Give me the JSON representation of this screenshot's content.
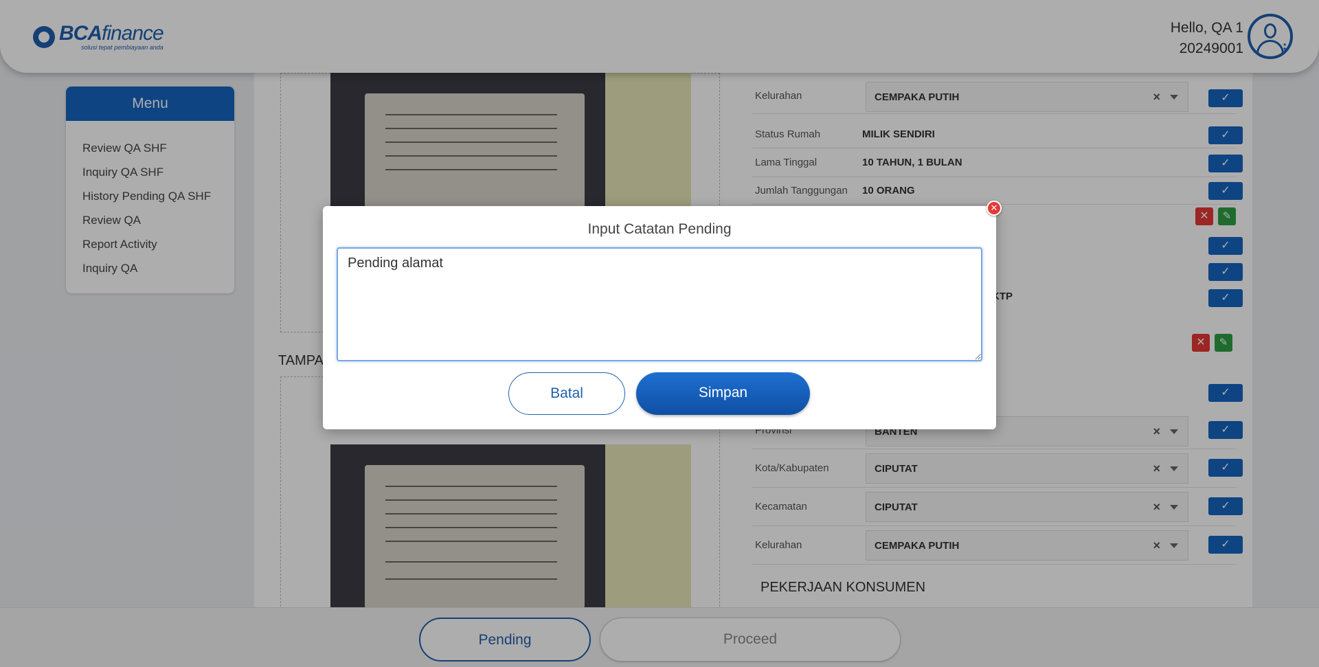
{
  "header": {
    "logo_brand": "BCA",
    "logo_finance": "finance",
    "logo_tagline": "solusi tepat pembiayaan anda",
    "greeting": "Hello, QA 1",
    "user_id": "20249001"
  },
  "menu": {
    "title": "Menu",
    "items": [
      {
        "label": "Review QA SHF"
      },
      {
        "label": "Inquiry QA SHF"
      },
      {
        "label": "History Pending QA SHF"
      },
      {
        "label": "Review QA"
      },
      {
        "label": "Report Activity"
      },
      {
        "label": "Inquiry QA"
      }
    ]
  },
  "left_panel": {
    "section_label_partial": "TAMPA"
  },
  "right_panel": {
    "rows_top": [
      {
        "label": "Kelurahan",
        "value": "CEMPAKA PUTIH"
      },
      {
        "label": "Status Rumah",
        "value": "MILIK SENDIRI"
      },
      {
        "label": "Lama Tinggal",
        "value": "10 TAHUN, 1 BULAN"
      },
      {
        "label": "Jumlah Tanggungan",
        "value": "10 ORANG"
      }
    ],
    "partial_value_ktp": "KTP",
    "rows_bottom": [
      {
        "label": "Provinsi",
        "value": "BANTEN"
      },
      {
        "label": "Kota/Kabupaten",
        "value": "CIPUTAT"
      },
      {
        "label": "Kecamatan",
        "value": "CIPUTAT"
      },
      {
        "label": "Kelurahan",
        "value": "CEMPAKA PUTIH"
      }
    ],
    "section_pekerjaan": "PEKERJAAN KONSUMEN",
    "check_glyph": "✓",
    "clear_glyph": "×"
  },
  "footer": {
    "pending_label": "Pending",
    "proceed_label": "Proceed"
  },
  "modal": {
    "title": "Input Catatan Pending",
    "textarea_value": "Pending alamat",
    "cancel_label": "Batal",
    "save_label": "Simpan",
    "close_glyph": "✕"
  },
  "colors": {
    "primary": "#1565c0",
    "danger": "#e53935",
    "success": "#2e9e44"
  }
}
